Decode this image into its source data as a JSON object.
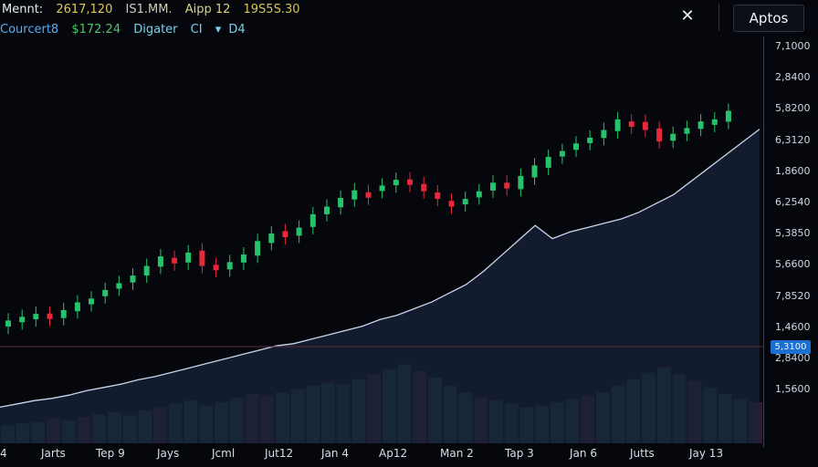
{
  "header": {
    "line1": [
      "Mennt:",
      "2617,120",
      "IS1.MM.",
      "Aipp 12",
      "19S5S.30"
    ],
    "line1_colors": [
      "#e8edf3",
      "#e1c85a",
      "#cfcfb6",
      "#d8d188",
      "#d7c45a"
    ],
    "line2": [
      "Courcert8",
      "$172.24",
      "Digater",
      "CI",
      "▾",
      "D4"
    ],
    "line2_colors": [
      "#57aef0",
      "#4fc26a",
      "#7bd0ea",
      "#7bd0ea",
      "#7bd0ea",
      "#7bd0ea"
    ]
  },
  "toolbar": {
    "close_label": "✕",
    "button_label": "Aptos"
  },
  "y_axis": {
    "labels": [
      "7,1000",
      "2,8400",
      "5,8200",
      "6,3120",
      "1,8600",
      "6,2540",
      "5,3850",
      "5,6600",
      "7,8520",
      "1,4600",
      "2,8400",
      "1,5600"
    ]
  },
  "price_tag": "5,3100",
  "x_axis": {
    "labels": [
      "4",
      "Jarts",
      "Tep 9",
      "Jays",
      "Jcml",
      "Jut12",
      "Jan 4",
      "Ap12",
      "Man 2",
      "Tap 3",
      "Jan 6",
      "Jutts",
      "Jay 13"
    ]
  },
  "colors": {
    "bull": "#27c26b",
    "bear": "#e5283a",
    "line": "#c9d6ee",
    "area": "#18243a",
    "volume": "#1a3a3a",
    "volume_alt": "#3a1f35",
    "hline": "#5a2a3e"
  },
  "chart_data": {
    "type": "candlestick",
    "x_labels": [
      "4",
      "Jarts",
      "Tep 9",
      "Jays",
      "Jcml",
      "Jut12",
      "Jan 4",
      "Ap12",
      "Man 2",
      "Tap 3",
      "Jan 6",
      "Jutts",
      "Jay 13"
    ],
    "y_tick_labels": [
      "7,1000",
      "2,8400",
      "5,8200",
      "6,3120",
      "1,8600",
      "6,2540",
      "5,3850",
      "5,6600",
      "7,8520",
      "1,4600",
      "2,8400",
      "1,5600"
    ],
    "close_trend": [
      71,
      75,
      78,
      74,
      82,
      90,
      94,
      103,
      110,
      118,
      128,
      138,
      134,
      142,
      128,
      124,
      132,
      140,
      154,
      162,
      158,
      168,
      182,
      190,
      199,
      207,
      205,
      212,
      218,
      214,
      206,
      198,
      190,
      198,
      206,
      215,
      209,
      222,
      233,
      242,
      248,
      256,
      262,
      270,
      281,
      276,
      270,
      258,
      266,
      272,
      279,
      281,
      290
    ],
    "area_line": [
      8,
      11,
      14,
      16,
      19,
      23,
      26,
      29,
      33,
      36,
      40,
      44,
      48,
      52,
      56,
      60,
      64,
      66,
      70,
      74,
      78,
      82,
      88,
      92,
      98,
      104,
      112,
      120,
      132,
      146,
      160,
      174,
      162,
      168,
      172,
      176,
      180,
      186,
      194,
      202,
      214,
      226,
      238,
      250,
      262
    ],
    "volume": [
      22,
      24,
      26,
      30,
      28,
      32,
      35,
      38,
      34,
      40,
      44,
      48,
      52,
      46,
      50,
      55,
      60,
      58,
      62,
      66,
      70,
      74,
      72,
      78,
      84,
      90,
      96,
      88,
      80,
      70,
      62,
      56,
      52,
      48,
      44,
      46,
      50,
      54,
      58,
      62,
      70,
      78,
      86,
      92,
      84,
      76,
      68,
      60,
      54,
      50
    ],
    "reference_price": "5,3100",
    "grid": false
  }
}
